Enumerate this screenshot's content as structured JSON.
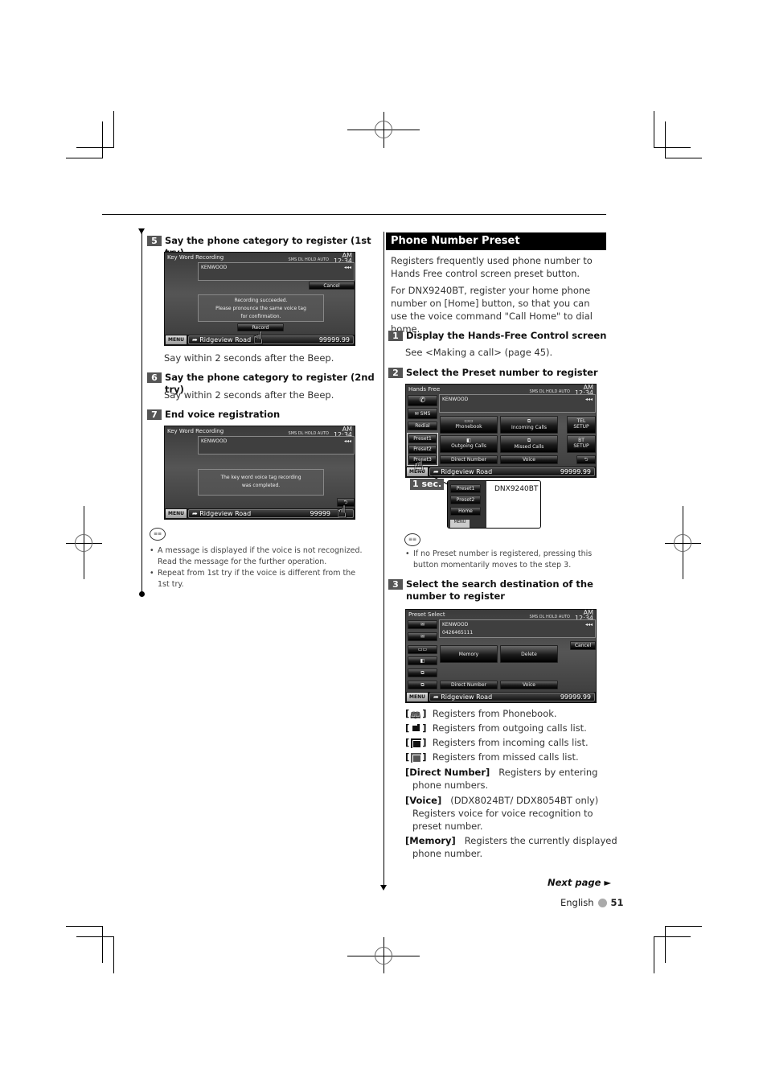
{
  "left": {
    "steps": [
      {
        "num": "5",
        "title": "Say the phone category to register (1st try)",
        "desc": "Say within 2 seconds after the Beep."
      },
      {
        "num": "6",
        "title": "Say the phone category to register (2nd try)",
        "desc": "Say within 2 seconds after the Beep."
      },
      {
        "num": "7",
        "title": "End voice registration"
      }
    ],
    "screen1": {
      "title": "Key Word Recording",
      "status": "SMS DL HOLD  AUTO",
      "clock_ampm": "AM",
      "clock": "12:34",
      "info": "KENWOOD",
      "cancel": "Cancel",
      "message": [
        "Recording succeeded.",
        "Please pronounce the same voice tag",
        "for confirmation."
      ],
      "record": "Record",
      "menu": "MENU",
      "road": "Ridgeview Road",
      "distance": "99999.99"
    },
    "screen2": {
      "title": "Key Word Recording",
      "status": "SMS DL HOLD  AUTO",
      "clock_ampm": "AM",
      "clock": "12:34",
      "info": "KENWOOD",
      "message": [
        "The key word voice tag recording",
        "was completed."
      ],
      "menu": "MENU",
      "road": "Ridgeview Road",
      "distance": "99999"
    },
    "notes": [
      "A message is displayed if the voice is not recognized. Read the message for the further operation.",
      "Repeat from 1st try if the voice is different from the 1st try."
    ]
  },
  "right": {
    "section_title": "Phone Number Preset",
    "intro1": "Registers frequently used phone number to Hands Free control screen preset button.",
    "intro2": "For DNX9240BT, register your home phone number on [Home] button, so that you can use the voice command \"Call Home\" to dial home.",
    "steps": [
      {
        "num": "1",
        "title": "Display the Hands-Free Control screen",
        "desc": "See <Making a call> (page 45)."
      },
      {
        "num": "2",
        "title": "Select the Preset number to register"
      },
      {
        "num": "3",
        "title": "Select the search destination of the number to register"
      }
    ],
    "hf_screen": {
      "title": "Hands Free",
      "status": "SMS DL HOLD  AUTO",
      "clock_ampm": "AM",
      "clock": "12:34",
      "info": "KENWOOD",
      "sms": "SMS",
      "redial": "Redial",
      "presets": [
        "Preset1",
        "Preset2",
        "Preset3"
      ],
      "buttons": {
        "phonebook": "Phonebook",
        "incoming": "Incoming Calls",
        "outgoing": "Outgoing Calls",
        "missed": "Missed Calls",
        "direct": "Direct Number",
        "voice": "Voice",
        "tel_setup": [
          "TEL",
          "SETUP"
        ],
        "bt_setup": [
          "BT",
          "SETUP"
        ]
      },
      "menu": "MENU",
      "road": "Ridgeview Road",
      "distance": "99999.99"
    },
    "hold_label": "1 sec.",
    "inset": {
      "presets": [
        "Preset1",
        "Preset2",
        "Home"
      ],
      "menu": "MENU",
      "model": "DNX9240BT"
    },
    "note": "If no Preset number is registered, pressing this button momentarily moves to the step 3.",
    "ps_screen": {
      "title": "Preset Select",
      "status": "SMS DL HOLD  AUTO",
      "clock_ampm": "AM",
      "clock": "12:34",
      "info_line1": "KENWOOD",
      "info_line2": "0426465111",
      "cancel": "Cancel",
      "memory": "Memory",
      "delete": "Delete",
      "direct": "Direct Number",
      "voice": "Voice",
      "menu": "MENU",
      "road": "Ridgeview Road",
      "distance": "99999.99"
    },
    "legend": [
      {
        "icon": "phonebook-icon",
        "text": "Registers from Phonebook."
      },
      {
        "icon": "outgoing-calls-icon",
        "text": "Registers from outgoing calls list."
      },
      {
        "icon": "incoming-calls-icon",
        "text": "Registers from incoming calls list."
      },
      {
        "icon": "missed-calls-icon",
        "text": "Registers from missed calls list."
      }
    ],
    "direct_label": "[Direct Number]",
    "direct_text": "Registers by entering phone numbers.",
    "voice_label": "[Voice]",
    "voice_text1": "(DDX8024BT/ DDX8054BT only)",
    "voice_text2": "Registers voice for voice recognition to preset number.",
    "memory_label": "[Memory]",
    "memory_text": "Registers the currently displayed phone number."
  },
  "footer": {
    "next_page": "Next page ►",
    "language": "English",
    "page_number": "51"
  }
}
